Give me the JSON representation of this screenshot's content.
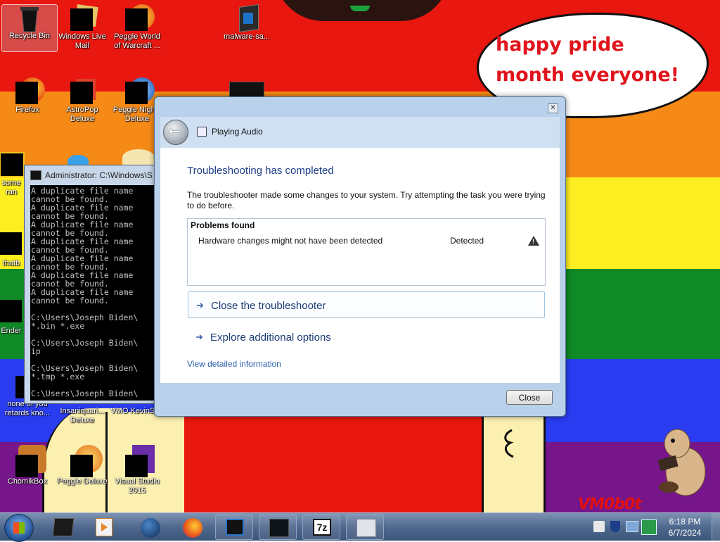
{
  "desktop": {
    "bubble_text": "happy pride month everyone!",
    "watermark": "VM0b0t",
    "icons": [
      {
        "label": "Recycle Bin"
      },
      {
        "label": "Windows Live Mail"
      },
      {
        "label": "Peggle World of Warcraft ..."
      },
      {
        "label": "malware-sa..."
      },
      {
        "label": "Firefox"
      },
      {
        "label": "AstroPop Deluxe"
      },
      {
        "label": "Peggle Nights Deluxe"
      },
      {
        "label": "some ran"
      },
      {
        "label": "thatb"
      },
      {
        "label": "Ender"
      },
      {
        "label": "none of you retards kno..."
      },
      {
        "label": "Insaniquari... Deluxe"
      },
      {
        "label": "VMO KevinSt..."
      },
      {
        "label": "ChomikBox"
      },
      {
        "label": "Peggle Deluxe"
      },
      {
        "label": "Visual Studio 2015"
      }
    ]
  },
  "console": {
    "title": "Administrator: C:\\Windows\\S",
    "lines": "A duplicate file name\ncannot be found.\nA duplicate file name\ncannot be found.\nA duplicate file name\ncannot be found.\nA duplicate file name\ncannot be found.\nA duplicate file name\ncannot be found.\nA duplicate file name\ncannot be found.\nA duplicate file name\ncannot be found.\n\nC:\\Users\\Joseph Biden\\\n*.bin *.exe\n\nC:\\Users\\Joseph Biden\\\nip\n\nC:\\Users\\Joseph Biden\\\n*.tmp *.exe\n\nC:\\Users\\Joseph Biden\\"
  },
  "dialog": {
    "close_glyph": "✕",
    "header_title": "Playing Audio",
    "heading": "Troubleshooting has completed",
    "description": "The troubleshooter made some changes to your system. Try attempting the task you were trying to do before.",
    "problems_header": "Problems found",
    "problem_name": "Hardware changes might not have been detected",
    "problem_status": "Detected",
    "link_close": "Close the troubleshooter",
    "link_explore": "Explore additional options",
    "detail_link": "View detailed information",
    "close_button": "Close"
  },
  "taskbar": {
    "items": [
      "windows-media-center",
      "windows-media-player",
      "globe",
      "firefox",
      "console",
      "winamp-style-app",
      "7-zip",
      "disk-utility"
    ],
    "time": "6:18 PM",
    "date": "6/7/2024"
  },
  "colors": {
    "accent_heading": "#1e3e8a",
    "link": "#2b5fae",
    "bubble_text": "#e0141c"
  }
}
